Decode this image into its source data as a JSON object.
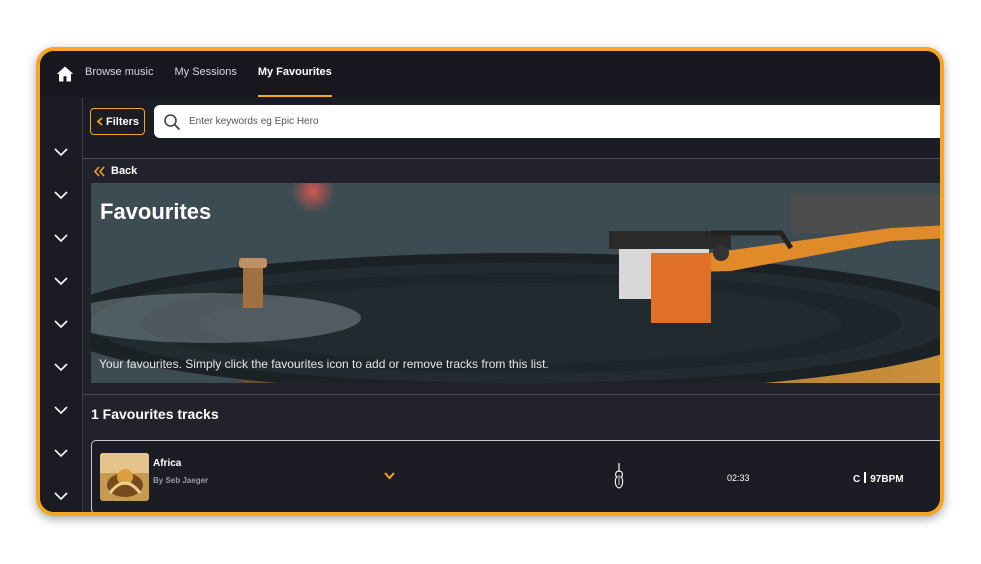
{
  "nav": {
    "items": [
      {
        "label": "Browse music",
        "active": false
      },
      {
        "label": "My Sessions",
        "active": false
      },
      {
        "label": "My Favourites",
        "active": true
      }
    ]
  },
  "sidebar": {
    "collapsed_sections": 9,
    "icon": "chevron-down-icon"
  },
  "search": {
    "filters_label": "Filters",
    "placeholder": "Enter keywords eg Epic Hero",
    "value": ""
  },
  "back_label": "Back",
  "hero": {
    "title": "Favourites",
    "subtitle": "Your favourites. Simply click the favourites icon to add or remove tracks from this list."
  },
  "tracks_heading": "1 Favourites tracks",
  "tracks": [
    {
      "title": "Africa",
      "artist": "By Seb Jaeger",
      "instrument_icon": "violin-icon",
      "duration": "02:33",
      "key": "C",
      "bpm": "97BPM"
    }
  ],
  "colors": {
    "accent": "#f5a623",
    "background": "#22222c",
    "topbar": "#171720"
  }
}
